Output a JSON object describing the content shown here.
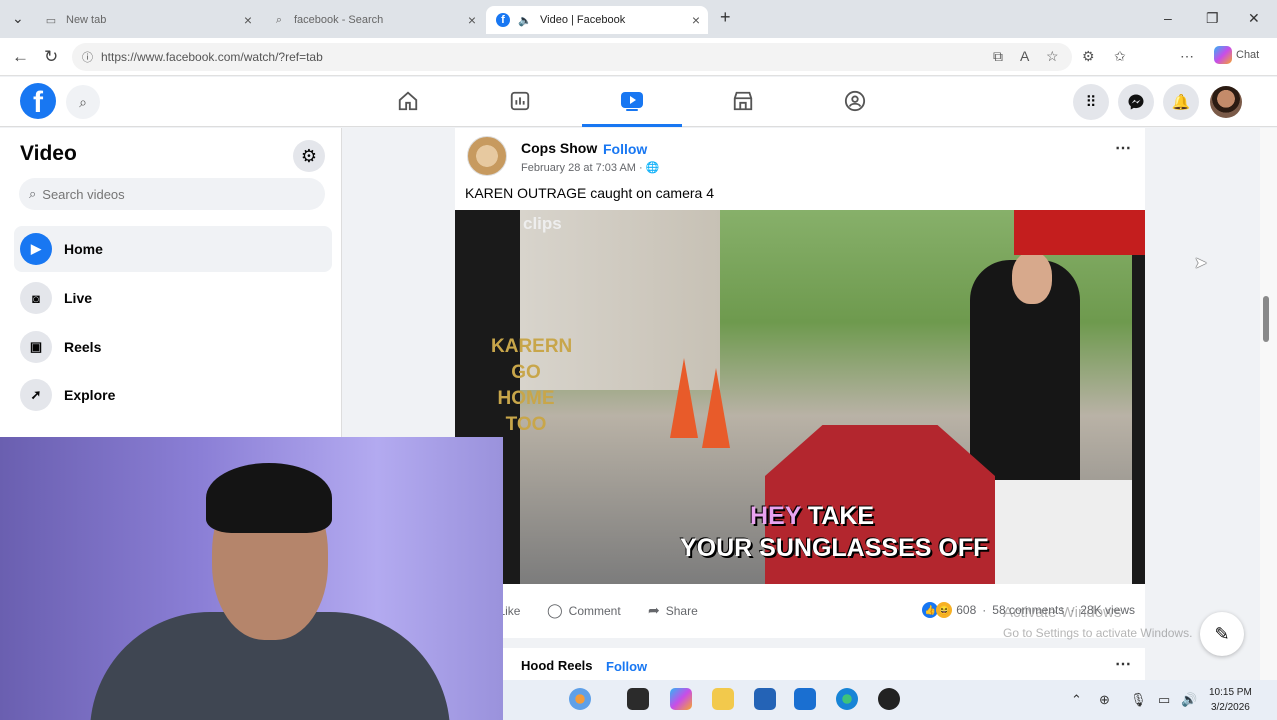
{
  "browser": {
    "tabs": [
      {
        "title": "New tab",
        "favicon": "new-tab-icon"
      },
      {
        "title": "facebook - Search",
        "favicon": "search-icon"
      },
      {
        "title": "Video | Facebook",
        "favicon": "facebook-icon"
      }
    ],
    "url": "https://www.facebook.com/watch/?ref=tab",
    "chat_label": "Chat"
  },
  "sidebar": {
    "title": "Video",
    "search_placeholder": "Search videos",
    "items": [
      {
        "label": "Home",
        "icon": "play-icon"
      },
      {
        "label": "Live",
        "icon": "live-video-icon"
      },
      {
        "label": "Reels",
        "icon": "reels-icon"
      },
      {
        "label": "Explore",
        "icon": "rocket-icon"
      }
    ]
  },
  "post": {
    "author": "Cops Show",
    "follow": "Follow",
    "date": "February 28 at 7:03 AM ·",
    "caption": "KAREN OUTRAGE caught on camera 4",
    "video_overlay": {
      "watermark": "clips",
      "side_text": [
        "KARERN",
        "GO",
        "HOME",
        "TOO"
      ],
      "subtitle_highlight": "HEY",
      "subtitle_line1_rest": "TAKE",
      "subtitle_line2": "YOUR SUNGLASSES OFF"
    },
    "actions": {
      "like": "Like",
      "comment": "Comment",
      "share": "Share"
    },
    "reaction_count": "608",
    "comments": "58 comments",
    "views": "28K views"
  },
  "post2": {
    "author": "Hood Reels",
    "follow": "Follow"
  },
  "watermark": {
    "line1": "Activate Windows",
    "line2": "Go to Settings to activate Windows."
  },
  "clock": {
    "time": "10:15 PM",
    "date": "3/2/2026"
  },
  "colors": {
    "brand": "#1877f2",
    "bg": "#f0f2f5"
  }
}
